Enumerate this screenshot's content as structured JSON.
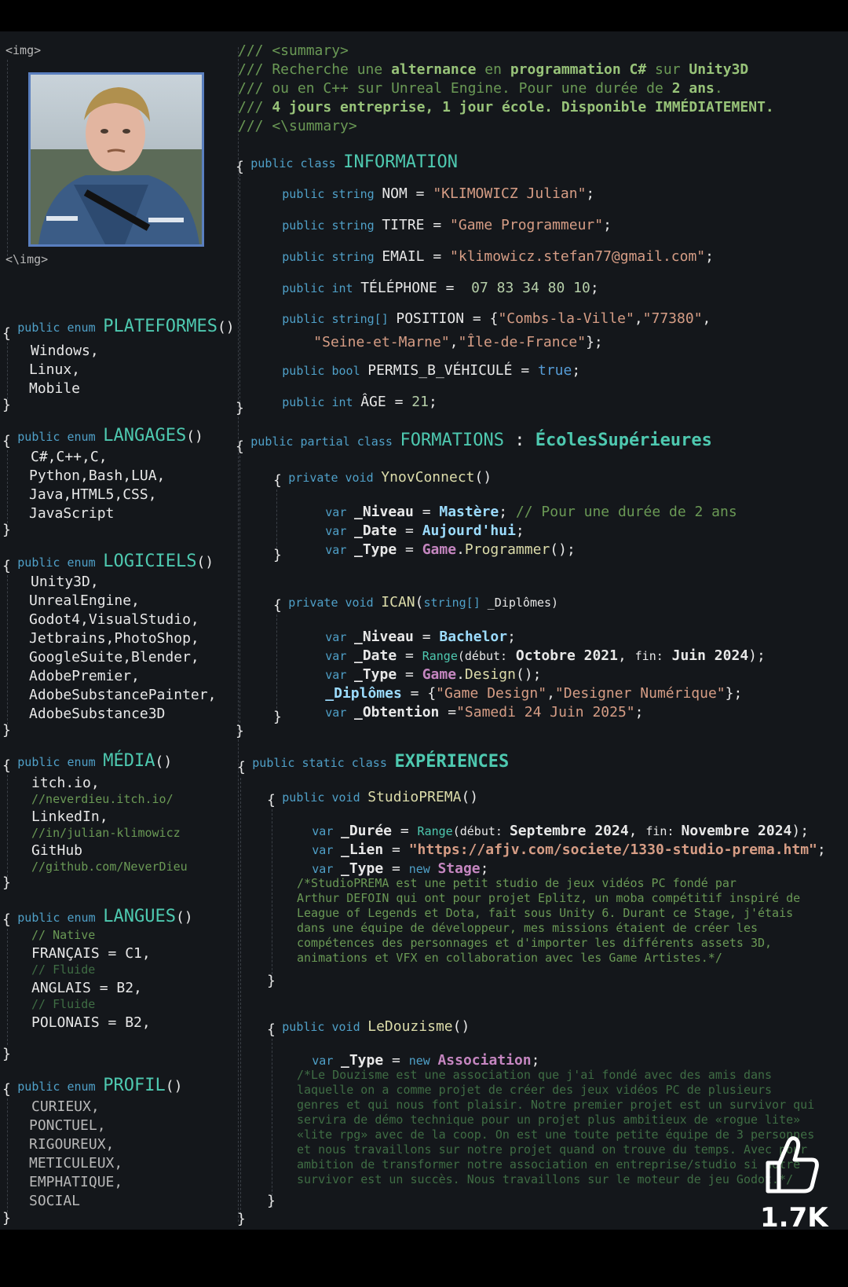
{
  "left": {
    "img_open": "<img>",
    "img_close": "<\\img>",
    "enums": [
      {
        "kw": "public enum",
        "name": "PLATEFORMES",
        "lines": [
          "Windows,",
          "Linux,",
          "Mobile"
        ]
      },
      {
        "kw": "public enum",
        "name": "LANGAGES",
        "lines": [
          "C#,C++,C,",
          "Python,Bash,LUA,",
          "Java,HTML5,CSS,",
          "JavaScript"
        ]
      },
      {
        "kw": "public enum",
        "name": "LOGICIELS",
        "lines": [
          "Unity3D,",
          "UnrealEngine,",
          "Godot4,VisualStudio,",
          "Jetbrains,PhotoShop,",
          "GoogleSuite,Blender,",
          "AdobePremier,",
          "AdobeSubstancePainter,",
          "AdobeSubstance3D"
        ]
      },
      {
        "kw": "public enum",
        "name": "MÉDIA",
        "lines": [
          "itch.io,",
          "//neverdieu.itch.io/",
          "LinkedIn,",
          "//in/julian-klimowicz",
          "GitHub",
          "//github.com/NeverDieu"
        ]
      },
      {
        "kw": "public enum",
        "name": "LANGUES",
        "lines": [
          "// Native",
          "FRANÇAIS = C1,",
          "// Fluide",
          "ANGLAIS = B2,",
          "// Fluide",
          "POLONAIS = B2,"
        ]
      },
      {
        "kw": "public enum",
        "name": "PROFIL",
        "lines": [
          "CURIEUX,",
          "PONCTUEL,",
          "RIGOUREUX,",
          "METICULEUX,",
          "EMPHATIQUE,",
          "SOCIAL"
        ]
      }
    ]
  },
  "summary": {
    "open": "/// <summary>",
    "l1a": "/// Recherche une ",
    "l1b": "alternance",
    "l1c": " en ",
    "l1d": "programmation C#",
    "l1e": " sur ",
    "l1f": "Unity3D",
    "l2a": "/// ou en C++ sur Unreal Engine. Pour une durée de ",
    "l2b": "2 ans",
    "l2c": ".",
    "l3a": "/// ",
    "l3b": "4 jours entreprise, 1 jour école. Disponible IMMÉDIATEMENT.",
    "close": "/// <\\summary>"
  },
  "information": {
    "decl_kw": "public class",
    "name": "INFORMATION",
    "nom_kw": "public string",
    "nom_key": "NOM",
    "nom_val": "\"KLIMOWICZ Julian\"",
    "titre_kw": "public string",
    "titre_key": "TITRE",
    "titre_val": "\"Game Programmeur\"",
    "email_kw": "public string",
    "email_key": "EMAIL",
    "email_val": "\"klimowicz.stefan77@gmail.com\"",
    "tel_kw": "public int",
    "tel_key": "TÉLÉPHONE",
    "tel_val": "07 83 34 80 10",
    "pos_kw": "public string[]",
    "pos_key": "POSITION",
    "pos_v1": "\"Combs-la-Ville\"",
    "pos_v2": "\"77380\"",
    "pos_v3": "\"Seine-et-Marne\"",
    "pos_v4": "\"Île-de-France\"",
    "permis_kw": "public bool",
    "permis_key": "PERMIS_B_VÉHICULÉ",
    "permis_val": "true",
    "age_kw": "public int",
    "age_key": "ÂGE",
    "age_val": "21"
  },
  "formations": {
    "decl_kw": "public partial class",
    "name": "FORMATIONS",
    "base": "ÉcolesSupérieures",
    "ynov_kw": "private void",
    "ynov_name": "YnovConnect",
    "ynov_niveau": "Mastère",
    "ynov_comment": "// Pour une durée de 2 ans",
    "ynov_date": "Aujourd'hui",
    "ynov_type_a": "Game",
    "ynov_type_b": "Programmer",
    "ican_kw": "private void",
    "ican_name": "ICAN",
    "ican_params": "string[] _Diplômes",
    "ican_niveau": "Bachelor",
    "ican_range": "Range",
    "ican_debut_lbl": "début:",
    "ican_debut": "Octobre 2021",
    "ican_fin_lbl": "fin:",
    "ican_fin": "Juin 2024",
    "ican_type_a": "Game",
    "ican_type_b": "Design",
    "ican_dip1": "\"Game Design\"",
    "ican_dip2": "\"Designer Numérique\"",
    "ican_obtention": "\"Samedi 24 Juin 2025\""
  },
  "experiences": {
    "decl_kw": "public static class",
    "name": "EXPÉRIENCES",
    "prema_kw": "public void",
    "prema_name": "StudioPREMA",
    "prema_range": "Range",
    "prema_debut": "Septembre 2024",
    "prema_fin": "Novembre 2024",
    "prema_lien": "\"https://afjv.com/societe/1330-studio-prema.htm\"",
    "prema_type": "Stage",
    "prema_desc": [
      "/*StudioPREMA est une petit studio de jeux vidéos PC fondé par",
      "Arthur DEFOIN qui ont pour projet Eplitz, un moba compétitif inspiré de",
      "League of Legends et Dota, fait sous Unity 6. Durant ce Stage, j'étais",
      "dans une équipe de développeur, mes missions étaient de créer les",
      "compétences des personnages et d'importer les différents assets 3D,",
      "animations et VFX en collaboration avec les Game Artistes.*/"
    ],
    "douz_kw": "public void",
    "douz_name": "LeDouzisme",
    "douz_type": "Association",
    "douz_desc": [
      "/*Le Douzisme est une association que j'ai fondé avec des amis dans",
      "laquelle on a comme projet de créer des jeux vidéos PC de plusieurs",
      "genres et qui nous font plaisir. Notre premier projet est un survivor qui",
      "servira de démo technique pour un projet plus ambitieux de «rogue lite»",
      "«lite rpg» avec de la coop. On est une toute petite équipe de 3 personnes",
      "et nous travaillons sur notre projet quand on trouve du temps. Avec pour",
      "ambition de transformer notre association en entreprise/studio si notre",
      "survivor est un succès. Nous travaillons sur le moteur de jeu Godot.*/"
    ]
  },
  "likes": "1.7K",
  "icons": {
    "like": "thumbs-up-icon"
  },
  "colors": {
    "background": "#14171b",
    "keyword": "#4fa0c8",
    "type": "#4ec9b0",
    "string": "#d69d85",
    "comment": "#6a9955"
  }
}
